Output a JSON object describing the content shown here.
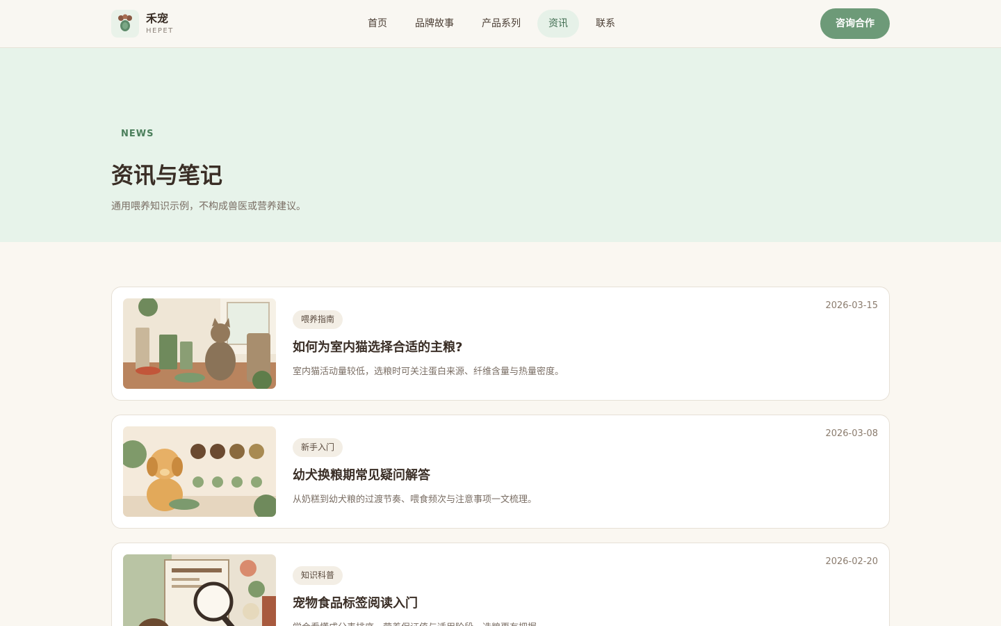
{
  "header": {
    "brand_cn": "禾宠",
    "brand_en": "HEPET",
    "nav": [
      {
        "label": "首页",
        "active": false
      },
      {
        "label": "品牌故事",
        "active": false
      },
      {
        "label": "产品系列",
        "active": false
      },
      {
        "label": "资讯",
        "active": true
      },
      {
        "label": "联系",
        "active": false
      }
    ],
    "cta_label": "咨询合作"
  },
  "hero": {
    "eyebrow": "NEWS",
    "title": "资讯与笔记",
    "subtitle": "通用喂养知识示例，不构成兽医或营养建议。"
  },
  "articles": [
    {
      "tag": "喂养指南",
      "title": "如何为室内猫选择合适的主粮?",
      "desc": "室内猫活动量较低，选粮时可关注蛋白来源、纤维含量与热量密度。",
      "date": "2026-03-15",
      "image": "indoor-cat-food-illustration"
    },
    {
      "tag": "新手入门",
      "title": "幼犬换粮期常见疑问解答",
      "desc": "从奶糕到幼犬粮的过渡节奏、喂食频次与注意事项一文梳理。",
      "date": "2026-03-08",
      "image": "puppy-food-transition-illustration"
    },
    {
      "tag": "知识科普",
      "title": "宠物食品标签阅读入门",
      "desc": "学会看懂成分表排序、营养保证值与适用阶段，选粮更有把握。",
      "date": "2026-02-20",
      "image": "pet-food-label-illustration"
    }
  ],
  "colors": {
    "accent": "#6d9a78",
    "hero_bg": "#e7f3ea",
    "page_bg": "#faf7f1"
  }
}
